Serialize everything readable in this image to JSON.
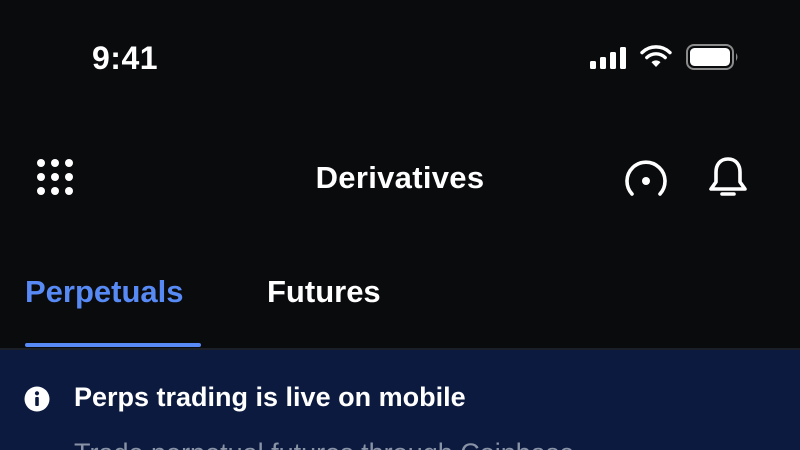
{
  "status_bar": {
    "time": "9:41"
  },
  "header": {
    "title": "Derivatives",
    "left_icon": "grid-menu-icon",
    "right_icons": [
      "gauge-icon",
      "bell-icon"
    ]
  },
  "tabs": [
    {
      "label": "Perpetuals",
      "active": true
    },
    {
      "label": "Futures",
      "active": false
    }
  ],
  "banner": {
    "icon": "info-icon",
    "title": "Perps trading is live on mobile",
    "body": "Trade perpetual futures through Coinbase"
  },
  "colors": {
    "background": "#0a0b0d",
    "accent": "#588af5",
    "banner_background": "#0b1a3e",
    "muted_text": "#8a93a6"
  }
}
